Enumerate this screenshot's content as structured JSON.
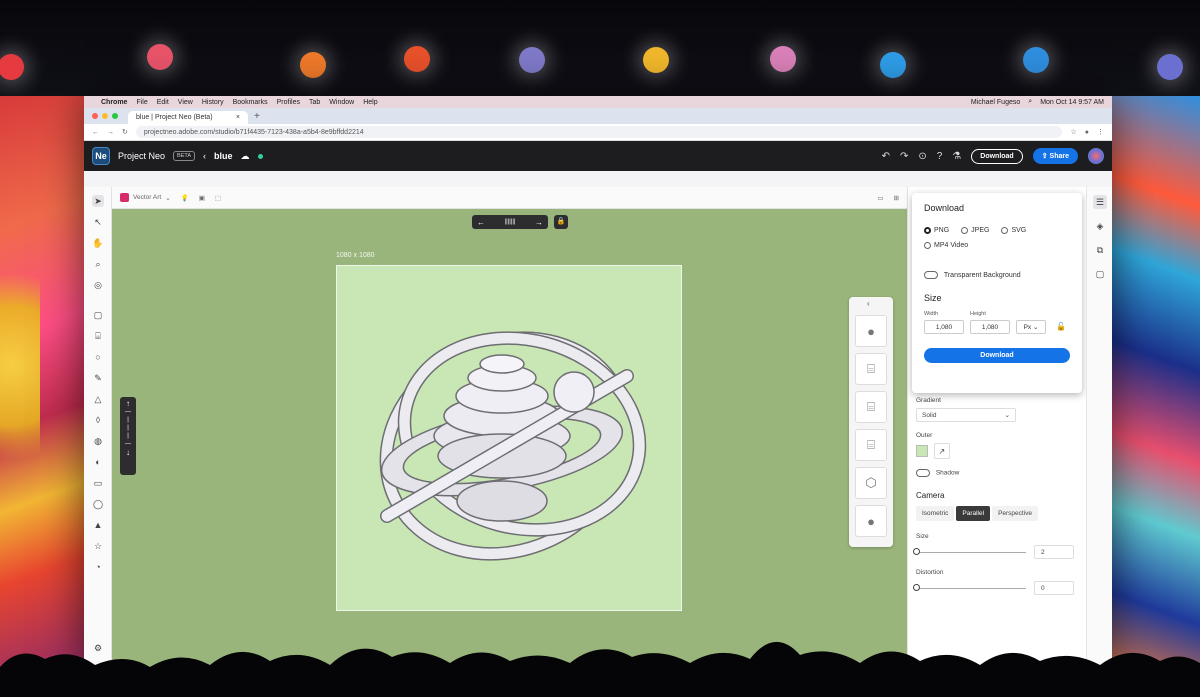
{
  "macos_menu": {
    "app": "Chrome",
    "items": [
      "File",
      "Edit",
      "View",
      "History",
      "Bookmarks",
      "Profiles",
      "Tab",
      "Window",
      "Help"
    ],
    "user": "Michael Fugeso",
    "datetime": "Mon Oct 14  9:57 AM"
  },
  "browser": {
    "tab_title": "blue | Project Neo (Beta)",
    "url": "projectneo.adobe.com/studio/b71f4435-7123-438a-a5b4-8e9bffdd2214"
  },
  "app": {
    "name": "Project Neo",
    "badge": "BETA",
    "doc_name": "blue",
    "download_label": "Download",
    "share_label": "Share"
  },
  "toolbar": {
    "style_label": "Vector Art"
  },
  "canvas": {
    "artboard_label": "1080 x 1080",
    "background_color": "#9ab57c",
    "artboard_color": "#c9e7b4"
  },
  "download_panel": {
    "title": "Download",
    "formats": [
      "PNG",
      "JPEG",
      "SVG"
    ],
    "selected_format": "PNG",
    "video_option": "MP4 Video",
    "transparent_label": "Transparent Background",
    "size_title": "Size",
    "width_label": "Width",
    "height_label": "Height",
    "width_value": "1,080",
    "height_value": "1,080",
    "unit": "Px",
    "button_label": "Download"
  },
  "properties": {
    "gradient_label": "Gradient",
    "gradient_value": "Solid",
    "outer_label": "Outer",
    "shadow_label": "Shadow",
    "camera_title": "Camera",
    "camera_modes": [
      "Isometric",
      "Parallel",
      "Perspective"
    ],
    "camera_selected": "Parallel",
    "size_label": "Size",
    "size_value": "2",
    "distortion_label": "Distortion",
    "distortion_value": "0"
  },
  "colors": {
    "accent": "#1473e6",
    "header_bg": "#1d1d1f"
  }
}
